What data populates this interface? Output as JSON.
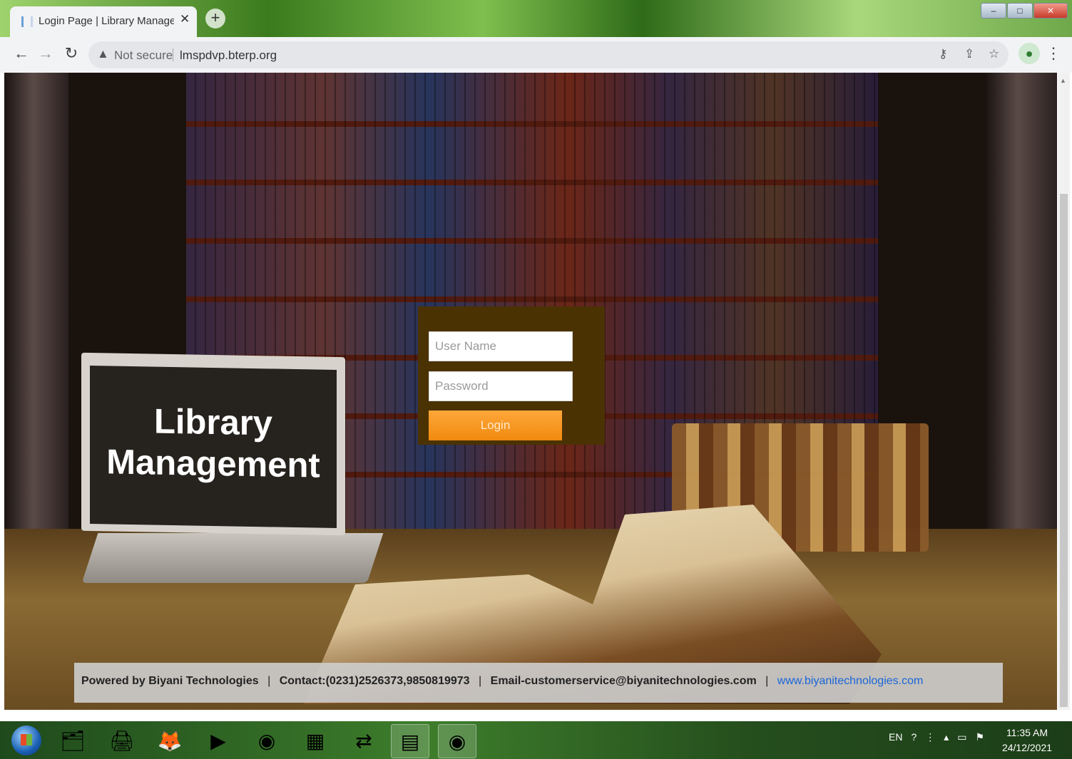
{
  "browser": {
    "tab_title": "Login Page | Library Managemen",
    "tab_close": "✕",
    "new_tab": "+",
    "window_controls": [
      "–",
      "□",
      "✕"
    ],
    "security_label": "Not secure",
    "url": "lmspdvp.bterp.org",
    "icons": [
      "back-icon",
      "forward-icon",
      "reload-icon",
      "warning-icon",
      "key-icon",
      "share-icon",
      "star-icon",
      "profile-icon",
      "menu-icon"
    ]
  },
  "page": {
    "hero_title_line1": "Library",
    "hero_title_line2": "Management",
    "login": {
      "username_placeholder": "User Name",
      "password_placeholder": "Password",
      "button_label": "Login"
    },
    "footer": {
      "powered_by": "Powered by Biyani Technologies",
      "contact": "Contact:(0231)2526373,9850819973",
      "email": "Email-customerservice@biyanitechnologies.com",
      "website": "www.biyanitechnologies.com"
    }
  },
  "taskbar": {
    "apps": [
      "explorer-icon",
      "scanner-icon",
      "firefox-icon",
      "media-player-icon",
      "chrome-icon",
      "excel-icon",
      "teamviewer-icon",
      "word-icon",
      "chrome-active-icon"
    ],
    "tray_language": "EN",
    "time": "11:35 AM",
    "date": "24/12/2021"
  },
  "colors": {
    "login_panel": "#4b3203",
    "login_button": "#f5961f",
    "footer_link": "#1a66d6"
  }
}
